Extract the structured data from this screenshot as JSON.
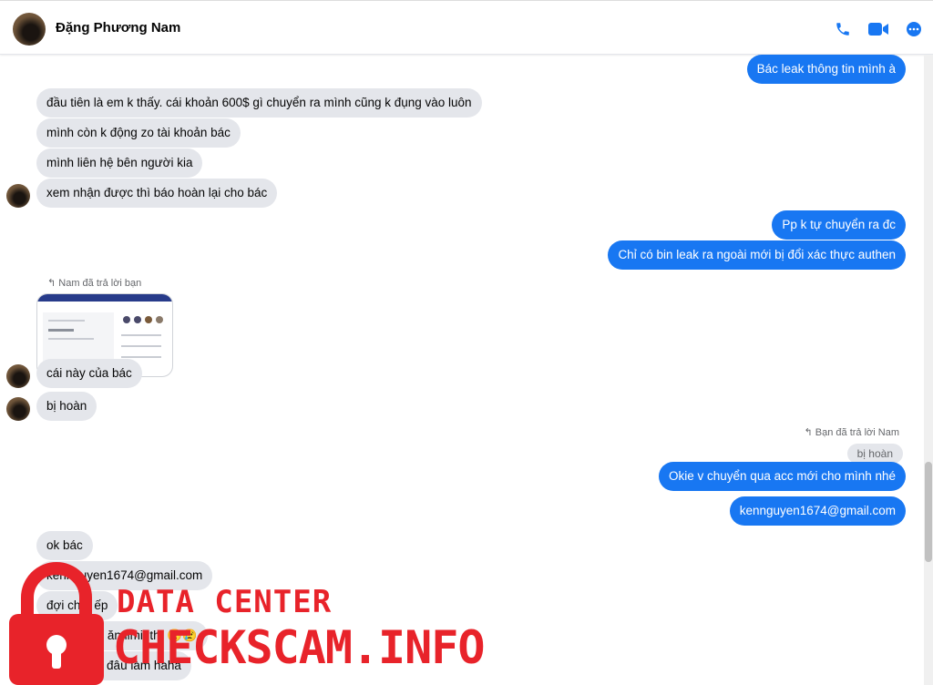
{
  "header": {
    "contact_name": "Đặng Phương Nam",
    "icons": [
      "phone-icon",
      "video-icon",
      "more-icon"
    ]
  },
  "colors": {
    "accent": "#1877f2",
    "incoming": "#e4e6eb",
    "watermark": "#e8232a"
  },
  "messages": {
    "m1": "Bác leak thông tin mình à",
    "m2": "đầu tiên là em k thấy. cái khoản 600$ gì chuyển ra mình cũng k đụng vào luôn",
    "m3": "mình còn k động zo tài khoản bác",
    "m4": "mình liên hệ bên người kia",
    "m5": "xem nhận được thì báo hoàn lại cho bác",
    "m6": "Pp k tự chuyển ra đc",
    "m7": "Chỉ có bin leak ra ngoài mới bị đổi xác thực authen",
    "reply1_note": "Nam đã trả lời bạn",
    "m8": "cái này của bác",
    "m9": "bị hoàn",
    "reply2_note": "Bạn đã trả lời Nam",
    "quote": "bị hoàn",
    "m10": "Okie v chuyển qua acc mới cho mình nhé",
    "m11": "kennguyen1674@gmail.com",
    "m12": "ok bác",
    "m13": "kennguyen1674@gmail.com",
    "m14": "đợi chút ếp",
    "m15": "chừ nó cái ăn limit thì 😢😢",
    "m16": "chẳng biết đâu làm haha"
  },
  "watermark": {
    "line1": "DATA CENTER",
    "line2": "CHECKSCAM.INFO"
  }
}
